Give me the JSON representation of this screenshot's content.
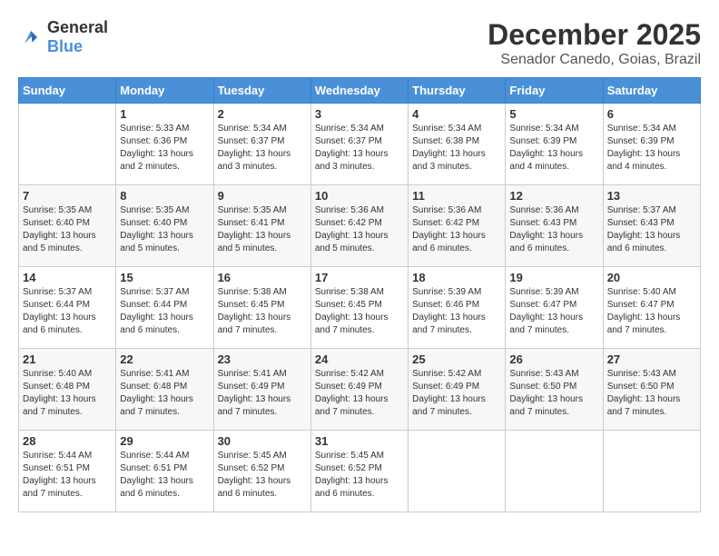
{
  "header": {
    "logo_line1": "General",
    "logo_line2": "Blue",
    "month": "December 2025",
    "location": "Senador Canedo, Goias, Brazil"
  },
  "days_of_week": [
    "Sunday",
    "Monday",
    "Tuesday",
    "Wednesday",
    "Thursday",
    "Friday",
    "Saturday"
  ],
  "weeks": [
    [
      {
        "day": "",
        "sunrise": "",
        "sunset": "",
        "daylight": ""
      },
      {
        "day": "1",
        "sunrise": "Sunrise: 5:33 AM",
        "sunset": "Sunset: 6:36 PM",
        "daylight": "Daylight: 13 hours and 2 minutes."
      },
      {
        "day": "2",
        "sunrise": "Sunrise: 5:34 AM",
        "sunset": "Sunset: 6:37 PM",
        "daylight": "Daylight: 13 hours and 3 minutes."
      },
      {
        "day": "3",
        "sunrise": "Sunrise: 5:34 AM",
        "sunset": "Sunset: 6:37 PM",
        "daylight": "Daylight: 13 hours and 3 minutes."
      },
      {
        "day": "4",
        "sunrise": "Sunrise: 5:34 AM",
        "sunset": "Sunset: 6:38 PM",
        "daylight": "Daylight: 13 hours and 3 minutes."
      },
      {
        "day": "5",
        "sunrise": "Sunrise: 5:34 AM",
        "sunset": "Sunset: 6:39 PM",
        "daylight": "Daylight: 13 hours and 4 minutes."
      },
      {
        "day": "6",
        "sunrise": "Sunrise: 5:34 AM",
        "sunset": "Sunset: 6:39 PM",
        "daylight": "Daylight: 13 hours and 4 minutes."
      }
    ],
    [
      {
        "day": "7",
        "sunrise": "Sunrise: 5:35 AM",
        "sunset": "Sunset: 6:40 PM",
        "daylight": "Daylight: 13 hours and 5 minutes."
      },
      {
        "day": "8",
        "sunrise": "Sunrise: 5:35 AM",
        "sunset": "Sunset: 6:40 PM",
        "daylight": "Daylight: 13 hours and 5 minutes."
      },
      {
        "day": "9",
        "sunrise": "Sunrise: 5:35 AM",
        "sunset": "Sunset: 6:41 PM",
        "daylight": "Daylight: 13 hours and 5 minutes."
      },
      {
        "day": "10",
        "sunrise": "Sunrise: 5:36 AM",
        "sunset": "Sunset: 6:42 PM",
        "daylight": "Daylight: 13 hours and 5 minutes."
      },
      {
        "day": "11",
        "sunrise": "Sunrise: 5:36 AM",
        "sunset": "Sunset: 6:42 PM",
        "daylight": "Daylight: 13 hours and 6 minutes."
      },
      {
        "day": "12",
        "sunrise": "Sunrise: 5:36 AM",
        "sunset": "Sunset: 6:43 PM",
        "daylight": "Daylight: 13 hours and 6 minutes."
      },
      {
        "day": "13",
        "sunrise": "Sunrise: 5:37 AM",
        "sunset": "Sunset: 6:43 PM",
        "daylight": "Daylight: 13 hours and 6 minutes."
      }
    ],
    [
      {
        "day": "14",
        "sunrise": "Sunrise: 5:37 AM",
        "sunset": "Sunset: 6:44 PM",
        "daylight": "Daylight: 13 hours and 6 minutes."
      },
      {
        "day": "15",
        "sunrise": "Sunrise: 5:37 AM",
        "sunset": "Sunset: 6:44 PM",
        "daylight": "Daylight: 13 hours and 6 minutes."
      },
      {
        "day": "16",
        "sunrise": "Sunrise: 5:38 AM",
        "sunset": "Sunset: 6:45 PM",
        "daylight": "Daylight: 13 hours and 7 minutes."
      },
      {
        "day": "17",
        "sunrise": "Sunrise: 5:38 AM",
        "sunset": "Sunset: 6:45 PM",
        "daylight": "Daylight: 13 hours and 7 minutes."
      },
      {
        "day": "18",
        "sunrise": "Sunrise: 5:39 AM",
        "sunset": "Sunset: 6:46 PM",
        "daylight": "Daylight: 13 hours and 7 minutes."
      },
      {
        "day": "19",
        "sunrise": "Sunrise: 5:39 AM",
        "sunset": "Sunset: 6:47 PM",
        "daylight": "Daylight: 13 hours and 7 minutes."
      },
      {
        "day": "20",
        "sunrise": "Sunrise: 5:40 AM",
        "sunset": "Sunset: 6:47 PM",
        "daylight": "Daylight: 13 hours and 7 minutes."
      }
    ],
    [
      {
        "day": "21",
        "sunrise": "Sunrise: 5:40 AM",
        "sunset": "Sunset: 6:48 PM",
        "daylight": "Daylight: 13 hours and 7 minutes."
      },
      {
        "day": "22",
        "sunrise": "Sunrise: 5:41 AM",
        "sunset": "Sunset: 6:48 PM",
        "daylight": "Daylight: 13 hours and 7 minutes."
      },
      {
        "day": "23",
        "sunrise": "Sunrise: 5:41 AM",
        "sunset": "Sunset: 6:49 PM",
        "daylight": "Daylight: 13 hours and 7 minutes."
      },
      {
        "day": "24",
        "sunrise": "Sunrise: 5:42 AM",
        "sunset": "Sunset: 6:49 PM",
        "daylight": "Daylight: 13 hours and 7 minutes."
      },
      {
        "day": "25",
        "sunrise": "Sunrise: 5:42 AM",
        "sunset": "Sunset: 6:49 PM",
        "daylight": "Daylight: 13 hours and 7 minutes."
      },
      {
        "day": "26",
        "sunrise": "Sunrise: 5:43 AM",
        "sunset": "Sunset: 6:50 PM",
        "daylight": "Daylight: 13 hours and 7 minutes."
      },
      {
        "day": "27",
        "sunrise": "Sunrise: 5:43 AM",
        "sunset": "Sunset: 6:50 PM",
        "daylight": "Daylight: 13 hours and 7 minutes."
      }
    ],
    [
      {
        "day": "28",
        "sunrise": "Sunrise: 5:44 AM",
        "sunset": "Sunset: 6:51 PM",
        "daylight": "Daylight: 13 hours and 7 minutes."
      },
      {
        "day": "29",
        "sunrise": "Sunrise: 5:44 AM",
        "sunset": "Sunset: 6:51 PM",
        "daylight": "Daylight: 13 hours and 6 minutes."
      },
      {
        "day": "30",
        "sunrise": "Sunrise: 5:45 AM",
        "sunset": "Sunset: 6:52 PM",
        "daylight": "Daylight: 13 hours and 6 minutes."
      },
      {
        "day": "31",
        "sunrise": "Sunrise: 5:45 AM",
        "sunset": "Sunset: 6:52 PM",
        "daylight": "Daylight: 13 hours and 6 minutes."
      },
      {
        "day": "",
        "sunrise": "",
        "sunset": "",
        "daylight": ""
      },
      {
        "day": "",
        "sunrise": "",
        "sunset": "",
        "daylight": ""
      },
      {
        "day": "",
        "sunrise": "",
        "sunset": "",
        "daylight": ""
      }
    ]
  ]
}
